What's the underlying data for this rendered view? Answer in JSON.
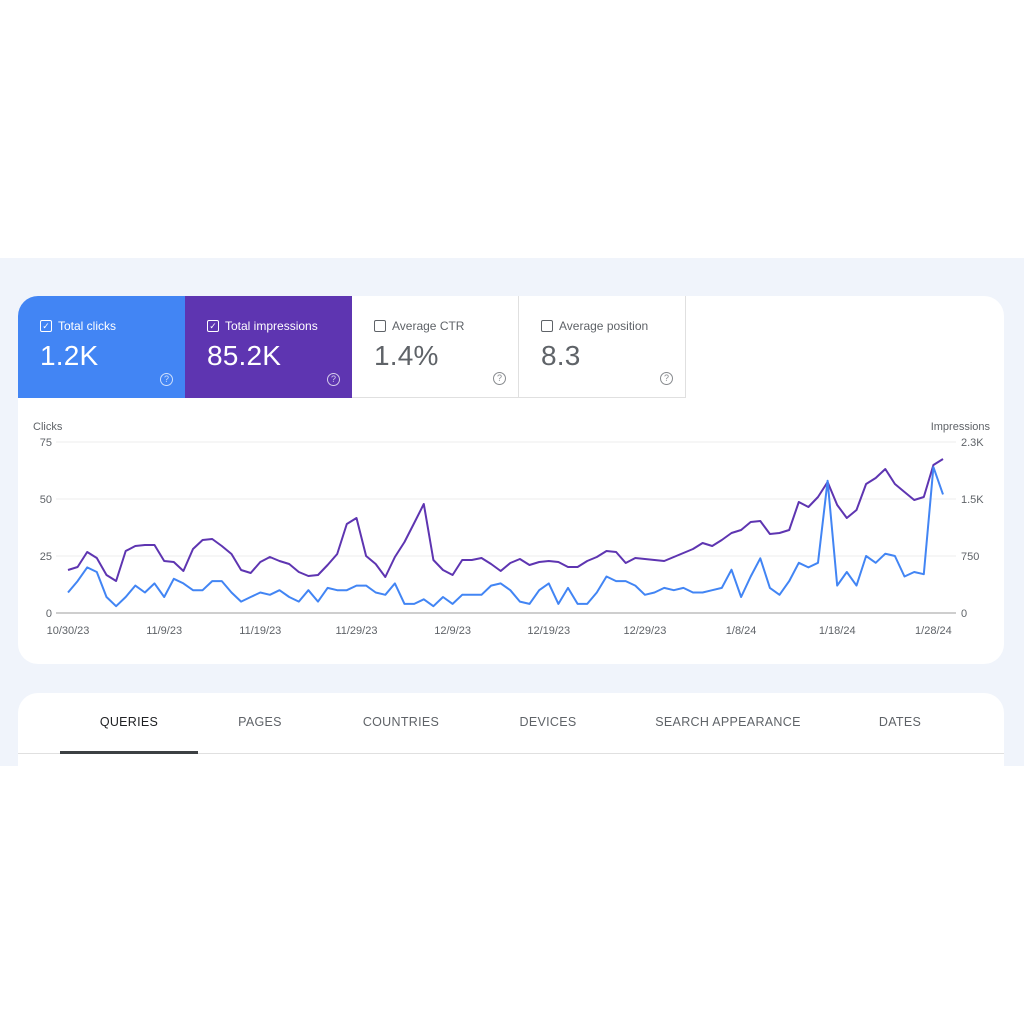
{
  "metrics": [
    {
      "label": "Total clicks",
      "value": "1.2K",
      "checked": true,
      "color": "#4285f4",
      "check_glyph": "✓",
      "help": "?"
    },
    {
      "label": "Total impressions",
      "value": "85.2K",
      "checked": true,
      "color": "#5e35b1",
      "check_glyph": "✓",
      "help": "?"
    },
    {
      "label": "Average CTR",
      "value": "1.4%",
      "checked": false,
      "color": "#ffffff",
      "check_glyph": "",
      "help": "?"
    },
    {
      "label": "Average position",
      "value": "8.3",
      "checked": false,
      "color": "#ffffff",
      "check_glyph": "",
      "help": "?"
    }
  ],
  "tabs": [
    {
      "label": "QUERIES",
      "active": true
    },
    {
      "label": "PAGES",
      "active": false
    },
    {
      "label": "COUNTRIES",
      "active": false
    },
    {
      "label": "DEVICES",
      "active": false
    },
    {
      "label": "SEARCH APPEARANCE",
      "active": false
    },
    {
      "label": "DATES",
      "active": false
    }
  ],
  "chart_data": {
    "type": "line",
    "title": "",
    "xlabel": "",
    "ylabel": "Clicks",
    "y2label": "Impressions",
    "ylim": [
      0,
      75
    ],
    "y2lim": [
      0,
      2250
    ],
    "yticks": [
      "0",
      "25",
      "50",
      "75"
    ],
    "y2ticks": [
      "0",
      "750",
      "1.5K",
      "2.3K"
    ],
    "xtick_labels": [
      "10/30/23",
      "11/9/23",
      "11/19/23",
      "11/29/23",
      "12/9/23",
      "12/19/23",
      "12/29/23",
      "1/8/24",
      "1/18/24",
      "1/28/24"
    ],
    "xtick_index": [
      0,
      10,
      20,
      30,
      40,
      50,
      60,
      70,
      80,
      90
    ],
    "grid": true,
    "series": [
      {
        "name": "Clicks",
        "axis": "left",
        "color": "#4285f4",
        "values": [
          9,
          14,
          20,
          18,
          7,
          3,
          7,
          12,
          9,
          13,
          7,
          15,
          13,
          10,
          10,
          14,
          14,
          9,
          5,
          7,
          9,
          8,
          10,
          7,
          5,
          10,
          5,
          11,
          10,
          10,
          12,
          12,
          9,
          8,
          13,
          4,
          4,
          6,
          3,
          7,
          4,
          8,
          8,
          8,
          12,
          13,
          10,
          5,
          4,
          10,
          13,
          4,
          11,
          4,
          4,
          9,
          16,
          14,
          14,
          12,
          8,
          9,
          11,
          10,
          11,
          9,
          9,
          10,
          11,
          19,
          7,
          16,
          24,
          11,
          8,
          14,
          22,
          20,
          22,
          58,
          12,
          18,
          12,
          25,
          22,
          26,
          25,
          16,
          18,
          17,
          64,
          52
        ]
      },
      {
        "name": "Impressions",
        "axis": "right",
        "color": "#5e35b1",
        "values": [
          566,
          605,
          803,
          724,
          500,
          421,
          816,
          882,
          895,
          895,
          684,
          671,
          553,
          842,
          960,
          974,
          882,
          776,
          566,
          526,
          671,
          737,
          684,
          645,
          539,
          487,
          500,
          632,
          776,
          1171,
          1250,
          750,
          645,
          474,
          737,
          934,
          1184,
          1434,
          697,
          566,
          500,
          697,
          697,
          724,
          645,
          553,
          658,
          711,
          632,
          671,
          684,
          671,
          605,
          605,
          684,
          737,
          816,
          803,
          658,
          724,
          711,
          697,
          684,
          737,
          789,
          842,
          921,
          882,
          960,
          1053,
          1092,
          1197,
          1211,
          1039,
          1053,
          1092,
          1461,
          1395,
          1526,
          1724,
          1421,
          1250,
          1355,
          1697,
          1776,
          1895,
          1697,
          1592,
          1487,
          1526,
          1947,
          2026
        ]
      }
    ]
  }
}
